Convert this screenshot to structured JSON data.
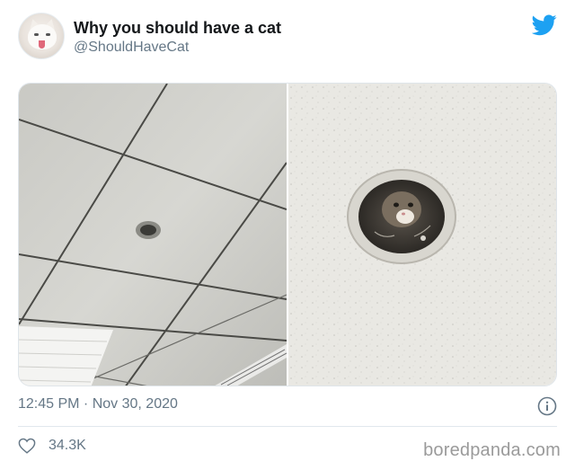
{
  "tweet": {
    "author": {
      "display_name": "Why you should have a cat",
      "handle": "@ShouldHaveCat"
    },
    "timestamp": "12:45 PM · Nov 30, 2020",
    "likes": "34.3K"
  },
  "icons": {
    "brand": "twitter-bird-icon",
    "info": "info-icon",
    "like": "heart-icon"
  },
  "colors": {
    "twitter_blue": "#1da1f2",
    "secondary_text": "#657786",
    "watermark": "#9a9a9a"
  },
  "watermark": {
    "text": "boredpanda.com"
  }
}
